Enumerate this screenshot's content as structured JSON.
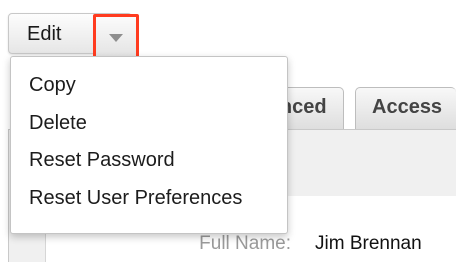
{
  "toolbar": {
    "edit_label": "Edit",
    "dropdown_toggle_icon": "chevron-down-icon",
    "highlight_color": "#ff3b1f"
  },
  "tabs": [
    {
      "label": "Advanced"
    },
    {
      "label": "Access"
    }
  ],
  "menu": {
    "items": [
      {
        "label": "Copy"
      },
      {
        "label": "Delete"
      },
      {
        "label": "Reset Password"
      },
      {
        "label": "Reset User Preferences"
      }
    ]
  },
  "detail": {
    "full_name_label": "Full Name:",
    "full_name_value": "Jim Brennan"
  }
}
